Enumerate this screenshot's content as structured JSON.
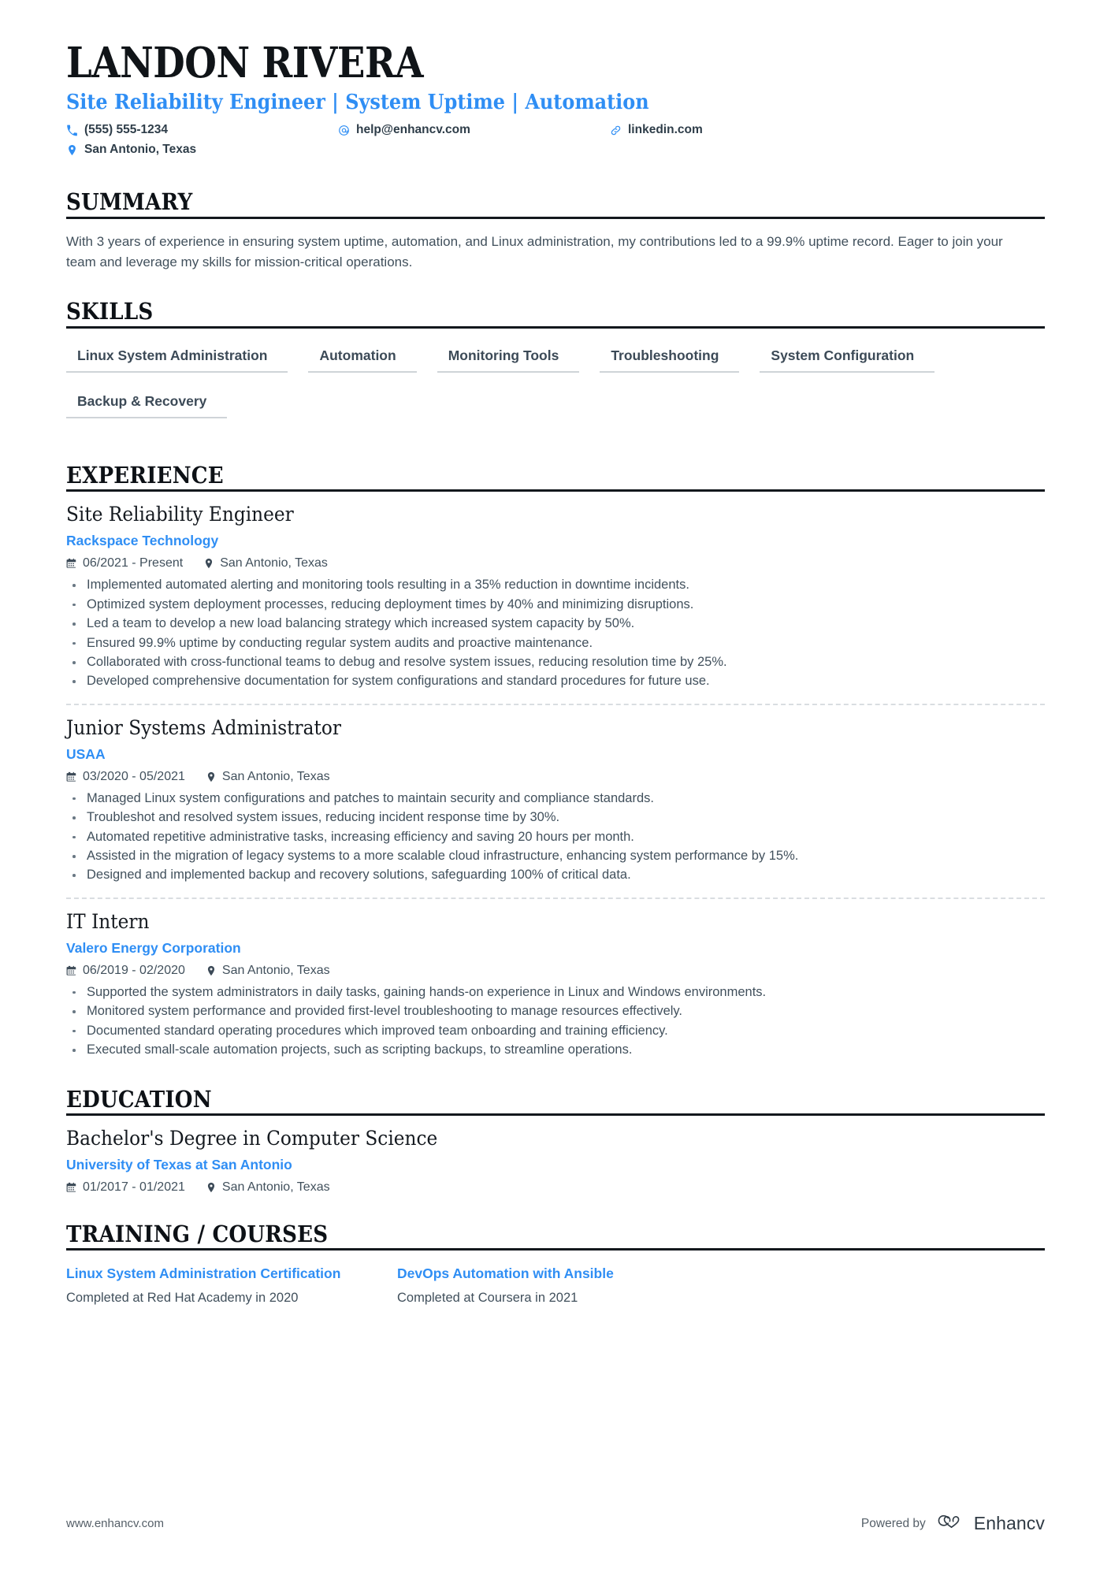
{
  "header": {
    "name": "LANDON RIVERA",
    "headline": "Site Reliability Engineer | System Uptime | Automation",
    "contacts": [
      {
        "icon": "phone-icon",
        "text": "(555) 555-1234"
      },
      {
        "icon": "email-icon",
        "text": "help@enhancv.com"
      },
      {
        "icon": "link-icon",
        "text": "linkedin.com"
      },
      {
        "icon": "location-icon",
        "text": "San Antonio, Texas"
      }
    ]
  },
  "sections": {
    "summary": {
      "heading": "SUMMARY",
      "text": "With 3 years of experience in ensuring system uptime, automation, and Linux administration, my contributions led to a 99.9% uptime record. Eager to join your team and leverage my skills for mission-critical operations."
    },
    "skills": {
      "heading": "SKILLS",
      "items": [
        "Linux System Administration",
        "Automation",
        "Monitoring Tools",
        "Troubleshooting",
        "System Configuration",
        "Backup & Recovery"
      ]
    },
    "experience": {
      "heading": "EXPERIENCE",
      "entries": [
        {
          "title": "Site Reliability Engineer",
          "org": "Rackspace Technology",
          "dates": "06/2021 - Present",
          "location": "San Antonio, Texas",
          "bullets": [
            "Implemented automated alerting and monitoring tools resulting in a 35% reduction in downtime incidents.",
            "Optimized system deployment processes, reducing deployment times by 40% and minimizing disruptions.",
            "Led a team to develop a new load balancing strategy which increased system capacity by 50%.",
            "Ensured 99.9% uptime by conducting regular system audits and proactive maintenance.",
            "Collaborated with cross-functional teams to debug and resolve system issues, reducing resolution time by 25%.",
            "Developed comprehensive documentation for system configurations and standard procedures for future use."
          ]
        },
        {
          "title": "Junior Systems Administrator",
          "org": "USAA",
          "dates": "03/2020 - 05/2021",
          "location": "San Antonio, Texas",
          "bullets": [
            "Managed Linux system configurations and patches to maintain security and compliance standards.",
            "Troubleshot and resolved system issues, reducing incident response time by 30%.",
            "Automated repetitive administrative tasks, increasing efficiency and saving 20 hours per month.",
            "Assisted in the migration of legacy systems to a more scalable cloud infrastructure, enhancing system performance by 15%.",
            "Designed and implemented backup and recovery solutions, safeguarding 100% of critical data."
          ]
        },
        {
          "title": "IT Intern",
          "org": "Valero Energy Corporation",
          "dates": "06/2019 - 02/2020",
          "location": "San Antonio, Texas",
          "bullets": [
            "Supported the system administrators in daily tasks, gaining hands-on experience in Linux and Windows environments.",
            "Monitored system performance and provided first-level troubleshooting to manage resources effectively.",
            "Documented standard operating procedures which improved team onboarding and training efficiency.",
            "Executed small-scale automation projects, such as scripting backups, to streamline operations."
          ]
        }
      ]
    },
    "education": {
      "heading": "EDUCATION",
      "entries": [
        {
          "title": "Bachelor's Degree in Computer Science",
          "org": "University of Texas at San Antonio",
          "dates": "01/2017 - 01/2021",
          "location": "San Antonio, Texas"
        }
      ]
    },
    "training": {
      "heading": "TRAINING / COURSES",
      "courses": [
        {
          "name": "Linux System Administration Certification",
          "desc": "Completed at Red Hat Academy in 2020"
        },
        {
          "name": "DevOps Automation with Ansible",
          "desc": "Completed at Coursera in 2021"
        }
      ]
    }
  },
  "footer": {
    "url": "www.enhancv.com",
    "powered_by": "Powered by",
    "brand": "Enhancv"
  },
  "colors": {
    "accent": "#2f8ef4",
    "text": "#41505c",
    "heading": "#0d1116",
    "rule": "#13181d"
  }
}
